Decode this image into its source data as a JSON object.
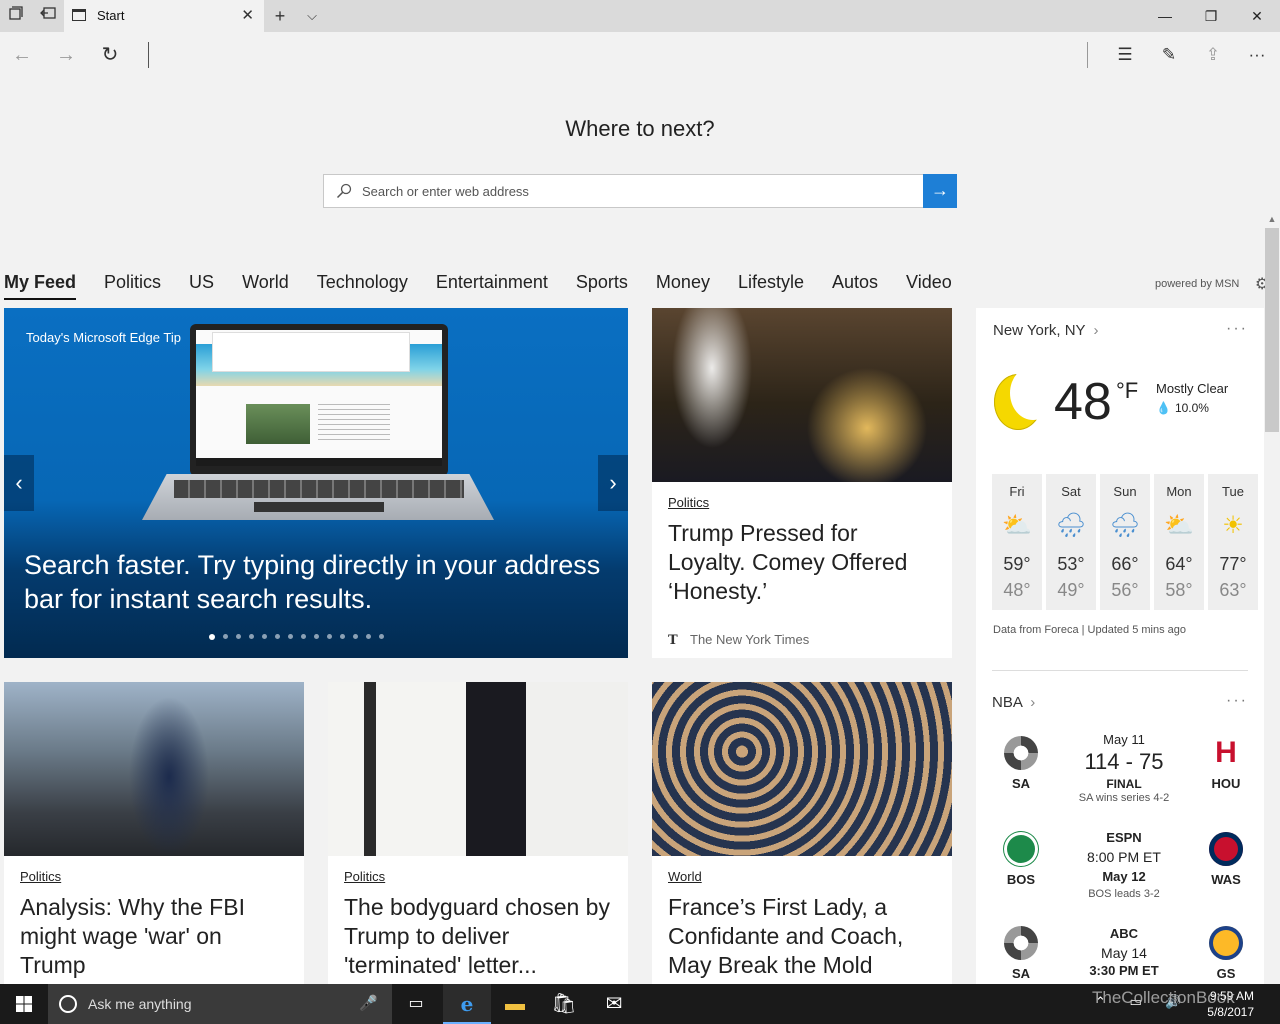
{
  "window": {
    "tab_title": "Start",
    "new_tab": "+",
    "tab_list": "⌵",
    "minimize": "—",
    "restore": "❐",
    "close": "✕"
  },
  "nav": {
    "back": "←",
    "forward": "→",
    "refresh": "↻",
    "hub": "☰",
    "notes": "✎",
    "share": "⇪",
    "more": "···"
  },
  "start": {
    "heading": "Where to next?",
    "search_placeholder": "Search or enter web address",
    "go": "→"
  },
  "categories": [
    "My Feed",
    "Politics",
    "US",
    "World",
    "Technology",
    "Entertainment",
    "Sports",
    "Money",
    "Lifestyle",
    "Autos",
    "Video"
  ],
  "powered_by": "powered by MSN",
  "hero": {
    "tip": "Today's Microsoft Edge Tip",
    "headline": "Search faster. Try typing directly in your address bar for instant search results.",
    "prev": "‹",
    "next": "›",
    "dot_count": 14,
    "active_dot": 1
  },
  "articles": [
    {
      "category": "Politics",
      "title": "Trump Pressed for Loyalty. Comey Offered ‘Honesty.’",
      "source": "The New York Times"
    },
    {
      "category": "Politics",
      "title": "Analysis: Why the FBI might wage 'war' on Trump"
    },
    {
      "category": "Politics",
      "title": "The bodyguard chosen by Trump to deliver 'terminated' letter..."
    },
    {
      "category": "World",
      "title": "France’s First Lady, a Confidante and Coach, May Break the Mold"
    }
  ],
  "weather": {
    "location": "New York, NY",
    "chevron": "›",
    "temp": "48",
    "unit": "°F",
    "condition": "Mostly Clear",
    "precip": "10.0%",
    "days": [
      {
        "name": "Fri",
        "icon": "partly-sunny-icon",
        "glyph": "⛅",
        "hi": "59°",
        "lo": "48°"
      },
      {
        "name": "Sat",
        "icon": "rain-icon",
        "glyph": "🌧",
        "hi": "53°",
        "lo": "49°"
      },
      {
        "name": "Sun",
        "icon": "rain-icon",
        "glyph": "🌧",
        "hi": "66°",
        "lo": "56°"
      },
      {
        "name": "Mon",
        "icon": "partly-sunny-icon",
        "glyph": "⛅",
        "hi": "64°",
        "lo": "58°"
      },
      {
        "name": "Tue",
        "icon": "sun-icon",
        "glyph": "☀",
        "hi": "77°",
        "lo": "63°"
      }
    ],
    "source": "Data from Foreca | Updated 5 mins ago"
  },
  "nba": {
    "title": "NBA",
    "chevron": "›",
    "games": [
      {
        "home": "SA",
        "away": "HOU",
        "date": "May 11",
        "score": "114 - 75",
        "status": "FINAL",
        "note": "SA wins series 4-2"
      },
      {
        "home": "BOS",
        "away": "WAS",
        "network": "ESPN",
        "time": "8:00 PM ET",
        "date": "May 12",
        "note": "BOS leads 3-2"
      },
      {
        "home": "SA",
        "away": "GS",
        "network": "ABC",
        "date": "May 14",
        "time": "3:30 PM ET"
      }
    ]
  },
  "taskbar": {
    "cortana_placeholder": "Ask me anything",
    "time": "9:59 AM",
    "date": "5/8/2017"
  },
  "watermark": "TheCollectionBook",
  "colors": {
    "accent": "#1e7fd6",
    "hero_blue": "#0767b5",
    "taskbar": "#1a1a1a"
  }
}
